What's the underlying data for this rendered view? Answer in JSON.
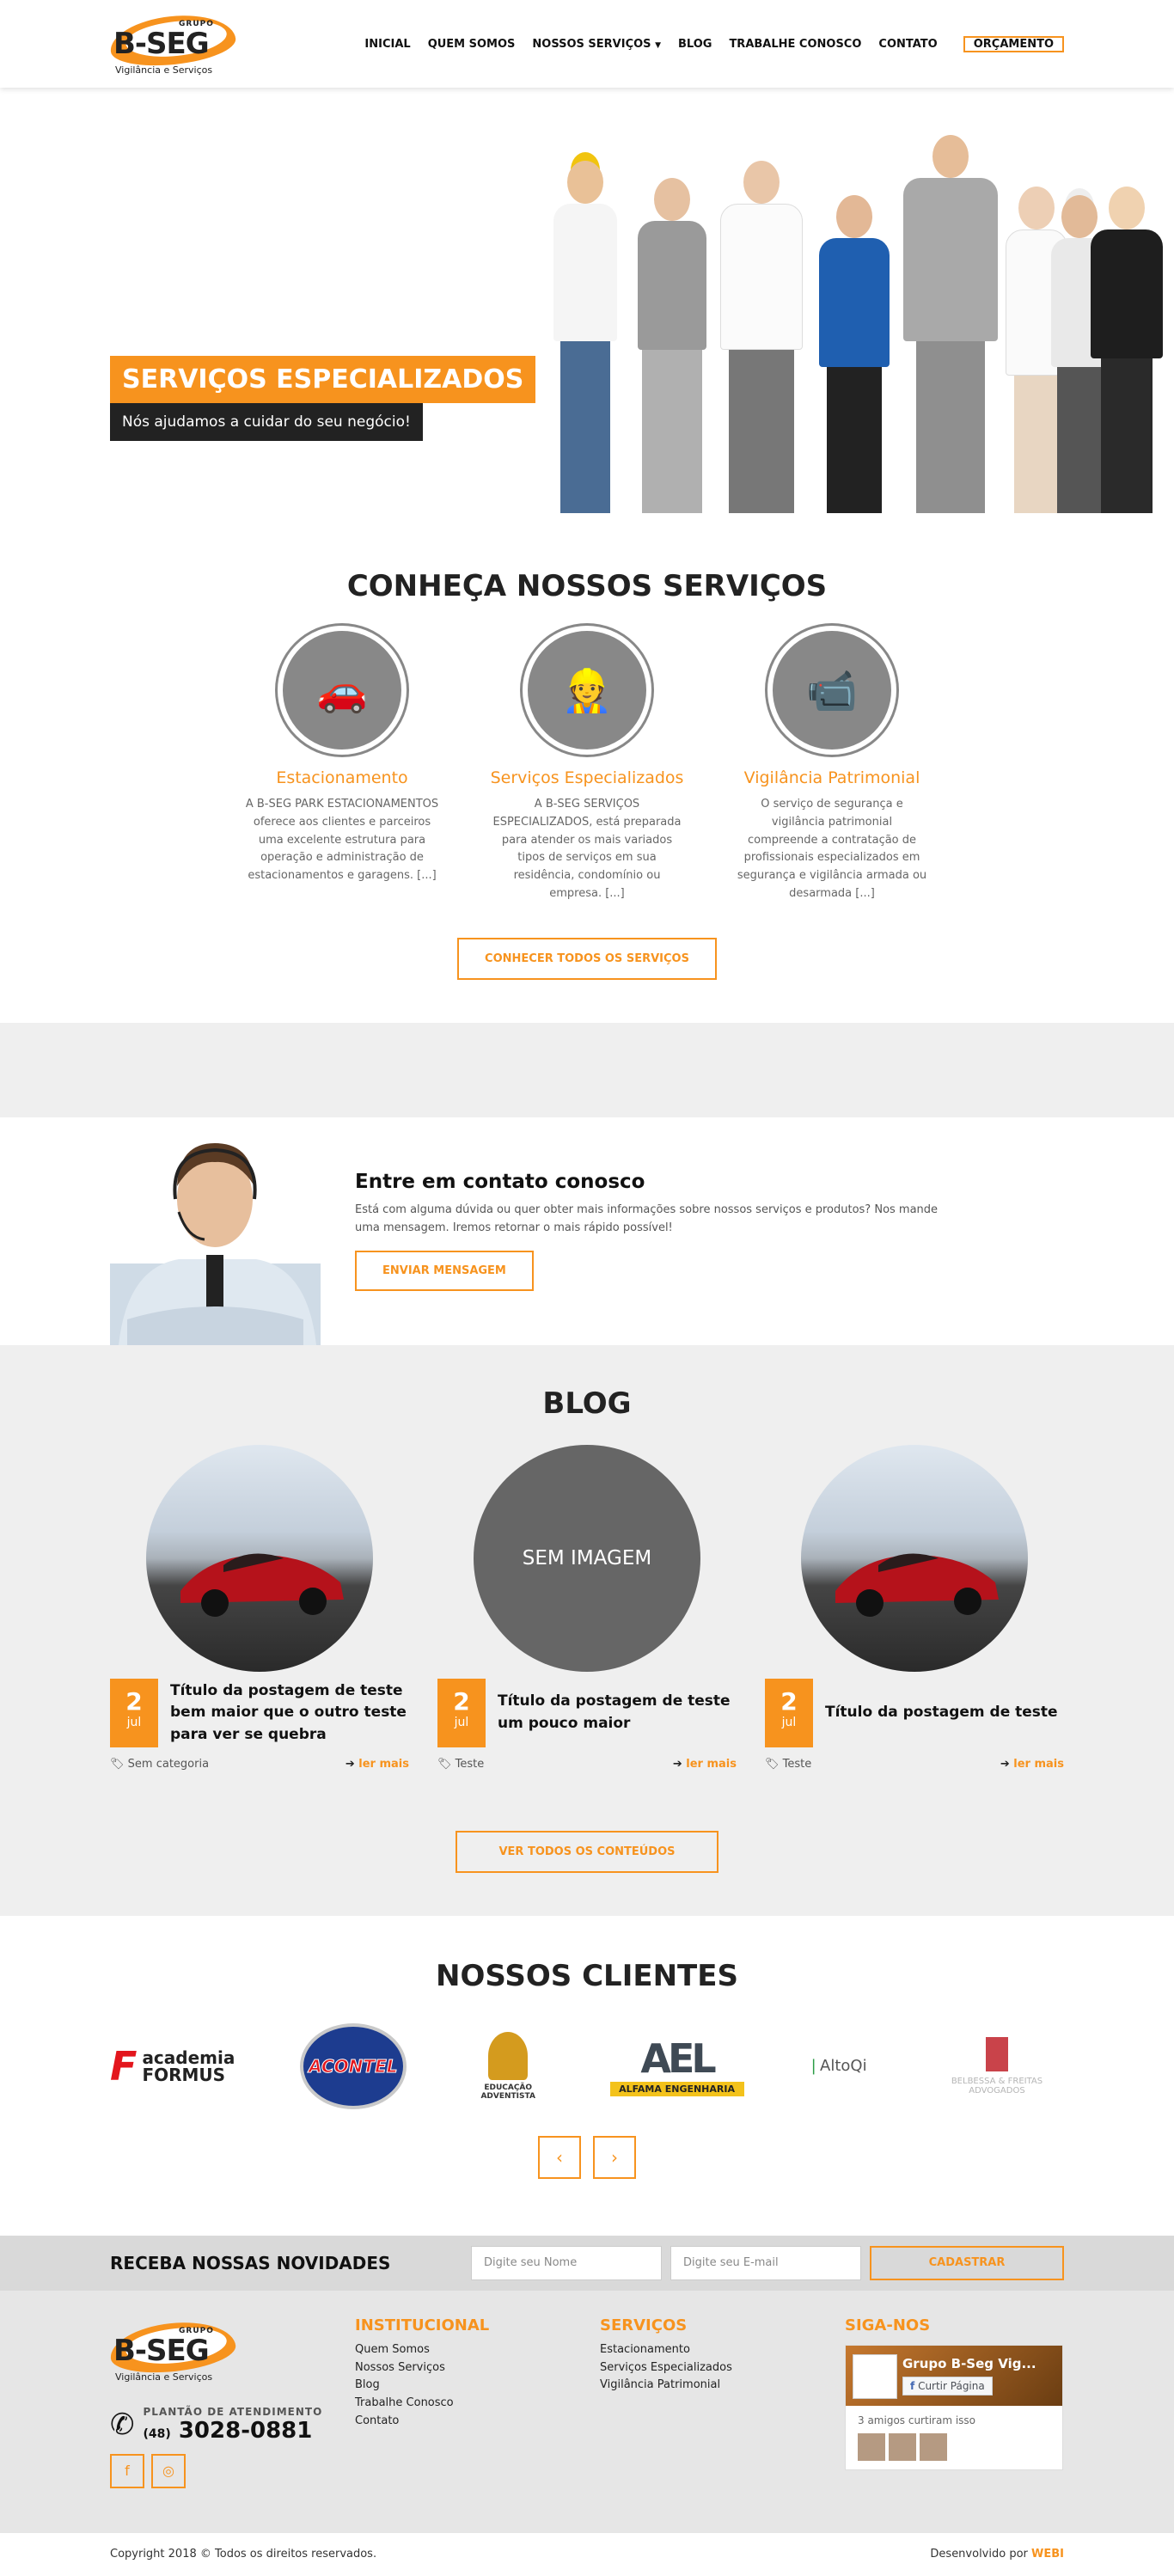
{
  "header": {
    "logo": {
      "grupo": "GRUPO",
      "brand": "B-SEG",
      "tagline": "Vigilância e Serviços"
    },
    "nav": [
      "INICIAL",
      "QUEM SOMOS",
      "NOSSOS SERVIÇOS",
      "BLOG",
      "TRABALHE CONOSCO",
      "CONTATO"
    ],
    "cta": "ORÇAMENTO"
  },
  "hero": {
    "title": "SERVIÇOS ESPECIALIZADOS",
    "subtitle": "Nós ajudamos a cuidar do seu negócio!"
  },
  "services": {
    "title": "CONHEÇA NOSSOS SERVIÇOS",
    "items": [
      {
        "title": "Estacionamento",
        "icon": "car-parking-icon",
        "text": "A B-SEG PARK ESTACIONAMENTOS oferece aos clientes e parceiros uma excelente estrutura para operação e administração de estacionamentos e garagens. [...]"
      },
      {
        "title": "Serviços Especializados",
        "icon": "cleaning-worker-icon",
        "text": "A B-SEG SERVIÇOS ESPECIALIZADOS, está preparada para atender os mais variados tipos de serviços em sua residência, condomínio ou empresa. [...]"
      },
      {
        "title": "Vigilância Patrimonial",
        "icon": "security-camera-icon",
        "text": "O serviço de segurança e vigilância patrimonial compreende a contratação de profissionais especializados em segurança e vigilância armada ou desarmada [...]"
      }
    ],
    "button": "CONHECER TODOS OS SERVIÇOS"
  },
  "contact": {
    "title": "Entre em contato conosco",
    "text": "Está com alguma dúvida ou quer obter mais informações sobre nossos serviços e produtos? Nos mande uma mensagem. Iremos retornar o mais rápido possível!",
    "button": "ENVIAR MENSAGEM"
  },
  "blog": {
    "title": "BLOG",
    "posts": [
      {
        "day": "2",
        "month": "jul",
        "title": "Título da postagem de teste bem maior que o outro teste para ver se quebra",
        "category": "Sem categoria",
        "more": "ler mais",
        "image": "car"
      },
      {
        "day": "2",
        "month": "jul",
        "title": "Título da postagem de teste um pouco maior",
        "category": "Teste",
        "more": "ler mais",
        "image": "none",
        "image_label": "SEM IMAGEM"
      },
      {
        "day": "2",
        "month": "jul",
        "title": "Título da postagem de teste",
        "category": "Teste",
        "more": "ler mais",
        "image": "car"
      }
    ],
    "button": "VER TODOS OS CONTEÚDOS"
  },
  "clients": {
    "title": "NOSSOS CLIENTES",
    "logos": [
      {
        "name": "academia FORMUS"
      },
      {
        "name": "ACONTEL"
      },
      {
        "name": "EDUCAÇÃO ADVENTISTA"
      },
      {
        "name": "ALFAMA ENGENHARIA"
      },
      {
        "name": "AltoQi"
      },
      {
        "name": "BELBESSA & FREITAS ADVOGADOS"
      }
    ]
  },
  "newsletter": {
    "title": "RECEBA NOSSAS NOVIDADES",
    "name_placeholder": "Digite seu Nome",
    "email_placeholder": "Digite seu E-mail",
    "button": "CADASTRAR"
  },
  "footer": {
    "plantao_label": "PLANTÃO DE ATENDIMENTO",
    "plantao_ddd": "(48)",
    "plantao_number": "3028-0881",
    "institucional": {
      "title": "INSTITUCIONAL",
      "links": [
        "Quem Somos",
        "Nossos Serviços",
        "Blog",
        "Trabalhe Conosco",
        "Contato"
      ]
    },
    "servicos": {
      "title": "SERVIÇOS",
      "links": [
        "Estacionamento",
        "Serviços Especializados",
        "Vigilância Patrimonial"
      ]
    },
    "siga": {
      "title": "SIGA-NOS",
      "fb_name": "Grupo B-Seg Vig...",
      "fb_like": "Curtir Página",
      "fb_friends": "3 amigos curtiram isso"
    },
    "copyright": "Copyright 2018 © Todos os direitos reservados.",
    "dev_label": "Desenvolvido por",
    "dev_name": "WEBI"
  },
  "colors": {
    "accent": "#f7931e",
    "dark": "#222222",
    "gray": "#efefef"
  }
}
